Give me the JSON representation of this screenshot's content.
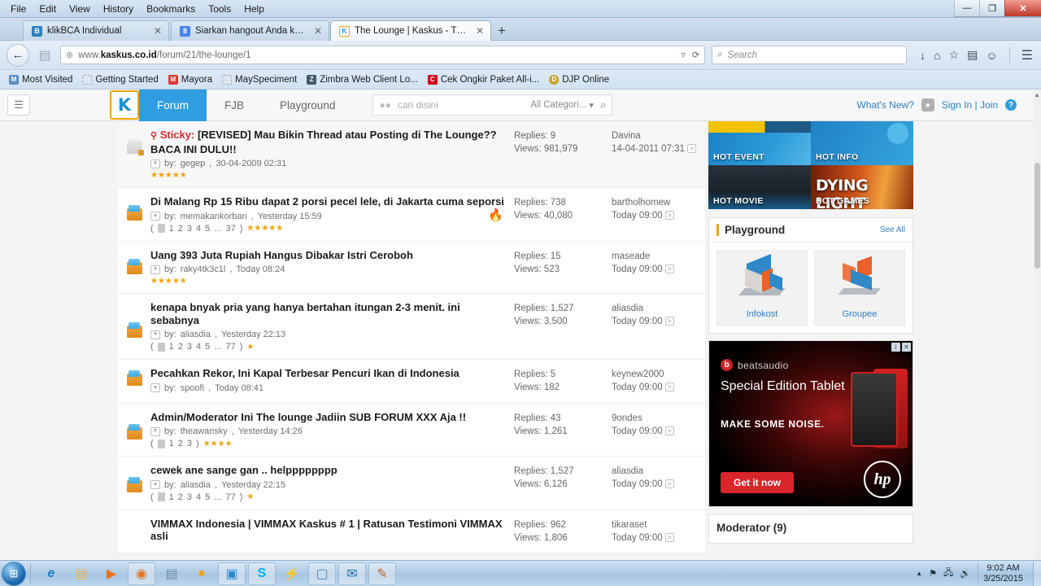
{
  "window": {
    "menu": [
      "File",
      "Edit",
      "View",
      "History",
      "Bookmarks",
      "Tools",
      "Help"
    ],
    "controls": {
      "minimize": "—",
      "maximize": "❐",
      "close": "✕"
    }
  },
  "tabs": [
    {
      "title": "klikBCA Individual",
      "favicon_name": "bca-favicon",
      "favicon_char": "B",
      "favicon_color": "#2f7fbf",
      "active": false,
      "close": "✕"
    },
    {
      "title": "Siarkan hangout Anda ke s...",
      "favicon_name": "google-favicon",
      "favicon_char": "8",
      "favicon_color": "#4285f4",
      "active": false,
      "close": "✕"
    },
    {
      "title": "The Lounge | Kaskus - The ...",
      "favicon_name": "kaskus-favicon",
      "favicon_char": "K",
      "favicon_color": "#f0a30a",
      "active": true,
      "close": "✕"
    }
  ],
  "new_tab_label": "+",
  "toolbar": {
    "back_icon": "←",
    "forward_icon": "▶",
    "url_host": "www.kaskus.co.id",
    "url_path": "/forum/21/the-lounge/1",
    "url_globe_icon": "⊕",
    "url_dropdown_icon": "▿",
    "url_reload_icon": "⟳",
    "search_placeholder": "Search",
    "search_icon": "⌕",
    "icons": [
      "↓",
      "⌂",
      "☆",
      "▤",
      "☺",
      "☰"
    ]
  },
  "bookmarks": [
    {
      "label": "Most Visited",
      "icon_char": "M",
      "icon_color": "#5b8fc4"
    },
    {
      "label": "Getting Started",
      "icon_char": "",
      "icon_color": "#cdd7e0"
    },
    {
      "label": "Mayora",
      "icon_char": "M",
      "icon_color": "#d93b3b"
    },
    {
      "label": "MaySpeciment",
      "icon_char": "",
      "icon_color": "#cdd7e0"
    },
    {
      "label": "Zimbra Web Client Lo...",
      "icon_char": "Z",
      "icon_color": "#46596b"
    },
    {
      "label": "Cek Ongkir Paket All-i...",
      "icon_char": "C",
      "icon_color": "#d0021b"
    },
    {
      "label": "DJP Online",
      "icon_char": "D",
      "icon_color": "#c9a227"
    }
  ],
  "site_header": {
    "burger_icon": "☰",
    "logo_char": "K",
    "nav": [
      {
        "label": "Forum",
        "active": true
      },
      {
        "label": "FJB",
        "active": false
      },
      {
        "label": "Playground",
        "active": false
      }
    ],
    "search": {
      "bubble_icon": "💬",
      "placeholder": "cari disini",
      "category": "All Categori...",
      "category_caret": "▾",
      "magnifier": "🔍"
    },
    "whats_new": "What's New?",
    "avatar_icon": "👤",
    "sign_in": "Sign In | Join",
    "help_icon": "?"
  },
  "threads": [
    {
      "sticky": true,
      "pin_icon": "📌",
      "sticky_label": "Sticky:",
      "title": "[REVISED] Mau Bikin Thread atau Posting di The Lounge?? BACA INI DULU!!",
      "by_prefix": "by:",
      "author": "gegep",
      "posted": "30-04-2009 02:31",
      "pages": null,
      "stars": 5,
      "hot": false,
      "replies": "Replies: 9",
      "views": "Views: 981,979",
      "last_user": "Davina",
      "last_time": "14-04-2011 07:31"
    },
    {
      "sticky": false,
      "title": "Di Malang Rp 15 Ribu dapat 2 porsi pecel lele, di Jakarta cuma seporsi",
      "by_prefix": "by:",
      "author": "memakankorban",
      "posted": "Yesterday 15:59",
      "pages": [
        "1",
        "2",
        "3",
        "4",
        "5",
        "...",
        "37"
      ],
      "stars": 5,
      "hot": true,
      "replies": "Replies: 738",
      "views": "Views: 40,080",
      "last_user": "bartholhomew",
      "last_time": "Today 09:00"
    },
    {
      "sticky": false,
      "title": "Uang 393 Juta Rupiah Hangus Dibakar Istri Ceroboh",
      "by_prefix": "by:",
      "author": "raky4tk3c1l",
      "posted": "Today 08:24",
      "pages": null,
      "stars": 5,
      "hot": false,
      "replies": "Replies: 15",
      "views": "Views: 523",
      "last_user": "maseade",
      "last_time": "Today 09:00"
    },
    {
      "sticky": false,
      "title": "kenapa bnyak pria yang hanya bertahan itungan 2-3 menit. ini sebabnya",
      "by_prefix": "by:",
      "author": "aliasdia",
      "posted": "Yesterday 22:13",
      "pages": [
        "1",
        "2",
        "3",
        "4",
        "5",
        "...",
        "77"
      ],
      "stars": 1,
      "hot": false,
      "replies": "Replies: 1,527",
      "views": "Views: 3,500",
      "last_user": "aliasdia",
      "last_time": "Today 09:00"
    },
    {
      "sticky": false,
      "title": "Pecahkan Rekor, Ini Kapal Terbesar Pencuri Ikan di Indonesia",
      "by_prefix": "by:",
      "author": "spoofi",
      "posted": "Today 08:41",
      "pages": null,
      "stars": 0,
      "hot": false,
      "replies": "Replies: 5",
      "views": "Views: 182",
      "last_user": "keynew2000",
      "last_time": "Today 09:00"
    },
    {
      "sticky": false,
      "title": "Admin/Moderator Ini The lounge Jadiin SUB FORUM XXX Aja !!",
      "by_prefix": "by:",
      "author": "theawansky",
      "posted": "Yesterday 14:26",
      "pages": [
        "1",
        "2",
        "3"
      ],
      "stars": 4,
      "hot": false,
      "replies": "Replies: 43",
      "views": "Views: 1,261",
      "last_user": "9ondes",
      "last_time": "Today 09:00"
    },
    {
      "sticky": false,
      "title": "cewek ane sange gan .. helpppppppp",
      "by_prefix": "by:",
      "author": "aliasdia",
      "posted": "Yesterday 22:15",
      "pages": [
        "1",
        "2",
        "3",
        "4",
        "5",
        "...",
        "77"
      ],
      "stars": 1,
      "hot": false,
      "replies": "Replies: 1,527",
      "views": "Views: 6,126",
      "last_user": "aliasdia",
      "last_time": "Today 09:00"
    },
    {
      "sticky": false,
      "title": "VIMMAX Indonesia | VIMMAX Kaskus # 1 | Ratusan Testimoni VIMMAX asli",
      "by_prefix": "by:",
      "author": "",
      "posted": "",
      "pages": null,
      "stars": 0,
      "hot": false,
      "replies": "Replies: 962",
      "views": "Views: 1,806",
      "last_user": "tikaraset",
      "last_time": "Today 09:00"
    }
  ],
  "sidebar": {
    "hot_tiles": [
      {
        "label": "HOT EVENT"
      },
      {
        "label": "HOT INFO"
      },
      {
        "label": "HOT MOVIE"
      },
      {
        "label": "HOT GAMES"
      }
    ],
    "hot_games_art_text": "DYING LIGHT",
    "playground": {
      "title": "Playground",
      "see_all": "See All",
      "cards": [
        {
          "label": "Infokost",
          "icon_name": "isometric-house-icon"
        },
        {
          "label": "Groupee",
          "icon_name": "isometric-chair-icon"
        }
      ]
    },
    "ad": {
      "brand": "beatsaudio",
      "brand_mark": "b",
      "headline": "Special Edition Tablet",
      "subhead": "MAKE SOME NOISE.",
      "cta": "Get it now",
      "logo": "hp",
      "info_icon": "i",
      "close_icon": "✕"
    },
    "moderator": {
      "title": "Moderator (9)"
    }
  },
  "taskbar": {
    "start_icon": "⊞",
    "items": [
      {
        "name": "internet-explorer",
        "icon": "e",
        "color": "#1b7fc4",
        "pinned": false
      },
      {
        "name": "file-explorer",
        "icon": "📁",
        "color": "#e8b64c",
        "pinned": false
      },
      {
        "name": "media-player",
        "icon": "▶",
        "color": "#e8731c",
        "pinned": false
      },
      {
        "name": "firefox",
        "icon": "🦊",
        "color": "#e8731c",
        "pinned": true
      },
      {
        "name": "notepad",
        "icon": "▤",
        "color": "#6e8ea8",
        "pinned": false
      },
      {
        "name": "opera",
        "icon": "◉",
        "color": "#e8a61c",
        "pinned": false
      },
      {
        "name": "photo-viewer",
        "icon": "🖼",
        "color": "#2f88c8",
        "pinned": true
      },
      {
        "name": "skype",
        "icon": "S",
        "color": "#00aff0",
        "pinned": true
      },
      {
        "name": "winamp",
        "icon": "⚡",
        "color": "#5a5a5a",
        "pinned": false
      },
      {
        "name": "remote-desktop",
        "icon": "🖥",
        "color": "#4a7fb5",
        "pinned": true
      },
      {
        "name": "thunderbird",
        "icon": "✉",
        "color": "#1b6fae",
        "pinned": true
      },
      {
        "name": "paint",
        "icon": "🎨",
        "color": "#c0632a",
        "pinned": true
      }
    ],
    "tray": {
      "expand_icon": "▲",
      "network_icon": "🖧",
      "security_icon": "⚑",
      "volume_icon": "🔊",
      "time": "9:02 AM",
      "date": "3/25/2015"
    }
  }
}
